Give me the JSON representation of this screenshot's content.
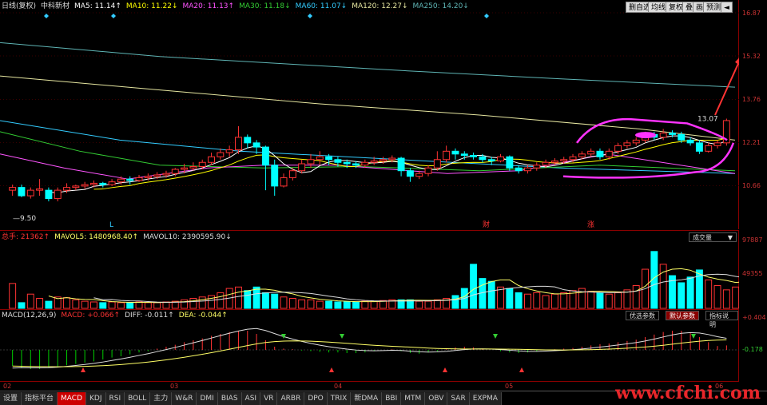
{
  "price_panel": {
    "period_label": "日线(复权)",
    "stock_name": "中科新材",
    "ma": [
      {
        "label": "MA5: 11.14↑",
        "color": "#ffffff"
      },
      {
        "label": "MA10: 11.22↓",
        "color": "#ffff00"
      },
      {
        "label": "MA20: 11.13↑",
        "color": "#ff55ff"
      },
      {
        "label": "MA30: 11.18↓",
        "color": "#33cc33"
      },
      {
        "label": "MA60: 11.07↓",
        "color": "#33ccff"
      },
      {
        "label": "MA120: 12.27↓",
        "color": "#e6e6a0"
      },
      {
        "label": "MA250: 14.20↓",
        "color": "#5fb5b5"
      }
    ],
    "toolbar": [
      "删自选",
      "均线",
      "复权",
      "叠",
      "画",
      "预测",
      "◄"
    ],
    "price_labels": [
      "16.87",
      "15.32",
      "13.76",
      "12.21",
      "10.66"
    ],
    "high_mark": "13.07",
    "low_mark": "9.50",
    "event_marks": [
      "L",
      "财",
      "涨"
    ]
  },
  "volume_panel": {
    "title": "总手: 21362↑",
    "mavol5": "MAVOL5: 1480968.40↑",
    "mavol10": "MAVOL10: 2390595.90↓",
    "selector": "成交量",
    "axis": [
      "97887",
      "49355"
    ]
  },
  "macd_panel": {
    "title": "MACD(12,26,9)",
    "macd": "MACD: +0.066↑",
    "diff": "DIFF: -0.011↑",
    "dea": "DEA: -0.044↑",
    "buttons": [
      "优选参数",
      "默认参数",
      "指标说明"
    ],
    "active_button": 1,
    "axis": [
      "+0.404",
      "-0.178"
    ]
  },
  "dates": [
    "02",
    "03",
    "04",
    "05",
    "06"
  ],
  "tabs": [
    "设置",
    "指标平台",
    "MACD",
    "KDJ",
    "RSI",
    "BOLL",
    "主力",
    "W&R",
    "DMI",
    "BIAS",
    "ASI",
    "VR",
    "ARBR",
    "DPO",
    "TRIX",
    "新DMA",
    "BBI",
    "MTM",
    "OBV",
    "SAR",
    "EXPMA"
  ],
  "active_tab": 2,
  "watermark": "www.cfchi.com",
  "colors": {
    "up": "#ff3333",
    "down": "#00ffff",
    "highlight": "#ff33ff",
    "arrow": "#ff3333"
  },
  "chart_data": {
    "type": "candlestick",
    "price_range": [
      9.5,
      16.87
    ],
    "candles": [
      [
        10.5,
        10.6,
        10.3,
        10.7
      ],
      [
        10.6,
        10.3,
        10.25,
        10.7
      ],
      [
        10.3,
        10.5,
        10.2,
        10.6
      ],
      [
        10.5,
        10.55,
        10.3,
        10.9
      ],
      [
        10.5,
        10.2,
        10.1,
        10.6
      ],
      [
        10.2,
        10.5,
        10.1,
        10.6
      ],
      [
        10.5,
        10.6,
        10.4,
        10.75
      ],
      [
        10.6,
        10.65,
        10.5,
        10.7
      ],
      [
        10.65,
        10.7,
        10.55,
        10.8
      ],
      [
        10.7,
        10.75,
        10.6,
        10.85
      ],
      [
        10.75,
        10.7,
        10.6,
        10.8
      ],
      [
        10.7,
        10.8,
        10.65,
        10.9
      ],
      [
        10.8,
        10.9,
        10.7,
        11.0
      ],
      [
        10.9,
        10.85,
        10.7,
        11.0
      ],
      [
        10.85,
        10.95,
        10.8,
        11.05
      ],
      [
        10.95,
        11.0,
        10.85,
        11.1
      ],
      [
        11.0,
        11.05,
        10.9,
        11.15
      ],
      [
        11.05,
        11.1,
        10.95,
        11.2
      ],
      [
        11.1,
        11.25,
        11.0,
        11.3
      ],
      [
        11.25,
        11.3,
        11.1,
        11.45
      ],
      [
        11.3,
        11.35,
        11.2,
        11.5
      ],
      [
        11.35,
        11.5,
        11.25,
        11.6
      ],
      [
        11.5,
        11.7,
        11.4,
        11.85
      ],
      [
        11.7,
        11.85,
        11.6,
        12.0
      ],
      [
        11.85,
        11.95,
        11.7,
        12.1
      ],
      [
        11.95,
        12.4,
        11.8,
        12.8
      ],
      [
        12.4,
        12.2,
        12.0,
        12.5
      ],
      [
        12.2,
        12.05,
        11.8,
        12.3
      ],
      [
        12.05,
        11.4,
        10.5,
        12.1
      ],
      [
        11.4,
        10.65,
        10.3,
        11.6
      ],
      [
        10.65,
        10.95,
        10.6,
        11.1
      ],
      [
        10.95,
        11.2,
        10.85,
        11.3
      ],
      [
        11.2,
        11.45,
        11.1,
        11.6
      ],
      [
        11.45,
        11.6,
        11.3,
        11.8
      ],
      [
        11.6,
        11.7,
        11.4,
        11.9
      ],
      [
        11.7,
        11.6,
        11.4,
        11.8
      ],
      [
        11.6,
        11.5,
        11.35,
        11.7
      ],
      [
        11.5,
        11.45,
        11.3,
        11.6
      ],
      [
        11.45,
        11.4,
        11.3,
        11.55
      ],
      [
        11.4,
        11.5,
        11.3,
        11.6
      ],
      [
        11.5,
        11.55,
        11.4,
        11.7
      ],
      [
        11.55,
        11.6,
        11.45,
        11.7
      ],
      [
        11.6,
        11.65,
        11.5,
        11.75
      ],
      [
        11.65,
        11.2,
        11.0,
        11.7
      ],
      [
        11.2,
        11.0,
        10.8,
        11.3
      ],
      [
        11.0,
        11.1,
        10.9,
        11.2
      ],
      [
        11.1,
        11.3,
        11.0,
        11.4
      ],
      [
        11.3,
        11.6,
        11.2,
        11.9
      ],
      [
        11.6,
        11.9,
        11.5,
        12.1
      ],
      [
        11.9,
        11.8,
        11.6,
        12.0
      ],
      [
        11.8,
        11.75,
        11.6,
        11.9
      ],
      [
        11.75,
        11.7,
        11.6,
        11.85
      ],
      [
        11.7,
        11.6,
        11.5,
        11.8
      ],
      [
        11.6,
        11.55,
        11.4,
        11.7
      ],
      [
        11.55,
        11.7,
        11.5,
        11.8
      ],
      [
        11.7,
        11.3,
        11.2,
        11.75
      ],
      [
        11.3,
        11.2,
        11.1,
        11.4
      ],
      [
        11.2,
        11.3,
        11.1,
        11.4
      ],
      [
        11.3,
        11.4,
        11.2,
        11.5
      ],
      [
        11.4,
        11.5,
        11.3,
        11.6
      ],
      [
        11.5,
        11.55,
        11.4,
        11.65
      ],
      [
        11.55,
        11.6,
        11.45,
        11.7
      ],
      [
        11.6,
        11.7,
        11.5,
        11.8
      ],
      [
        11.7,
        11.8,
        11.6,
        11.9
      ],
      [
        11.8,
        11.9,
        11.7,
        12.0
      ],
      [
        11.9,
        11.7,
        11.6,
        12.0
      ],
      [
        11.7,
        11.9,
        11.6,
        12.0
      ],
      [
        11.9,
        12.1,
        11.8,
        12.2
      ],
      [
        12.1,
        12.2,
        12.0,
        12.3
      ],
      [
        12.2,
        12.3,
        12.1,
        12.4
      ],
      [
        12.3,
        12.5,
        12.2,
        12.6
      ],
      [
        12.5,
        12.4,
        12.3,
        12.6
      ],
      [
        12.4,
        12.55,
        12.3,
        12.7
      ],
      [
        12.55,
        12.5,
        12.4,
        12.65
      ],
      [
        12.5,
        12.3,
        12.2,
        12.6
      ],
      [
        12.3,
        12.2,
        12.1,
        12.4
      ],
      [
        12.2,
        11.9,
        11.8,
        12.3
      ],
      [
        11.9,
        12.1,
        11.85,
        12.2
      ],
      [
        12.1,
        12.2,
        12.0,
        12.3
      ],
      [
        12.2,
        13.0,
        12.1,
        13.07
      ]
    ],
    "volumes": [
      35,
      8,
      20,
      14,
      10,
      16,
      15,
      12,
      10,
      9,
      8,
      9,
      8,
      8,
      9,
      8,
      8,
      9,
      10,
      12,
      14,
      16,
      18,
      22,
      28,
      30,
      25,
      30,
      22,
      20,
      16,
      14,
      12,
      12,
      10,
      10,
      9,
      9,
      9,
      10,
      10,
      11,
      12,
      12,
      12,
      10,
      10,
      12,
      14,
      18,
      28,
      62,
      42,
      38,
      30,
      28,
      22,
      20,
      22,
      18,
      20,
      22,
      25,
      28,
      24,
      22,
      20,
      22,
      26,
      32,
      55,
      80,
      62,
      46,
      36,
      44,
      54,
      40,
      32,
      26,
      30,
      60
    ],
    "macd_hist": [
      -0.25,
      -0.28,
      -0.3,
      -0.3,
      -0.28,
      -0.26,
      -0.24,
      -0.22,
      -0.2,
      -0.18,
      -0.15,
      -0.12,
      -0.1,
      -0.07,
      -0.04,
      -0.02,
      0.02,
      0.05,
      0.08,
      0.12,
      0.15,
      0.18,
      0.22,
      0.25,
      0.28,
      0.3,
      0.3,
      0.25,
      0.15,
      0.05,
      0.02,
      0.01,
      -0.01,
      -0.02,
      -0.03,
      -0.04,
      -0.04,
      -0.05,
      -0.05,
      -0.04,
      -0.02,
      0.0,
      0.01,
      -0.02,
      -0.05,
      -0.06,
      -0.04,
      -0.02,
      0.01,
      0.04,
      0.05,
      0.04,
      0.02,
      0.0,
      -0.02,
      -0.04,
      -0.05,
      -0.04,
      -0.02,
      0.0,
      0.01,
      0.02,
      0.03,
      0.05,
      0.07,
      0.09,
      0.1,
      0.12,
      0.14,
      0.16,
      0.2,
      0.24,
      0.28,
      0.3,
      0.3,
      0.26,
      0.2,
      0.12,
      0.06,
      0.07
    ],
    "macd_range": [
      -0.4,
      0.45
    ]
  }
}
